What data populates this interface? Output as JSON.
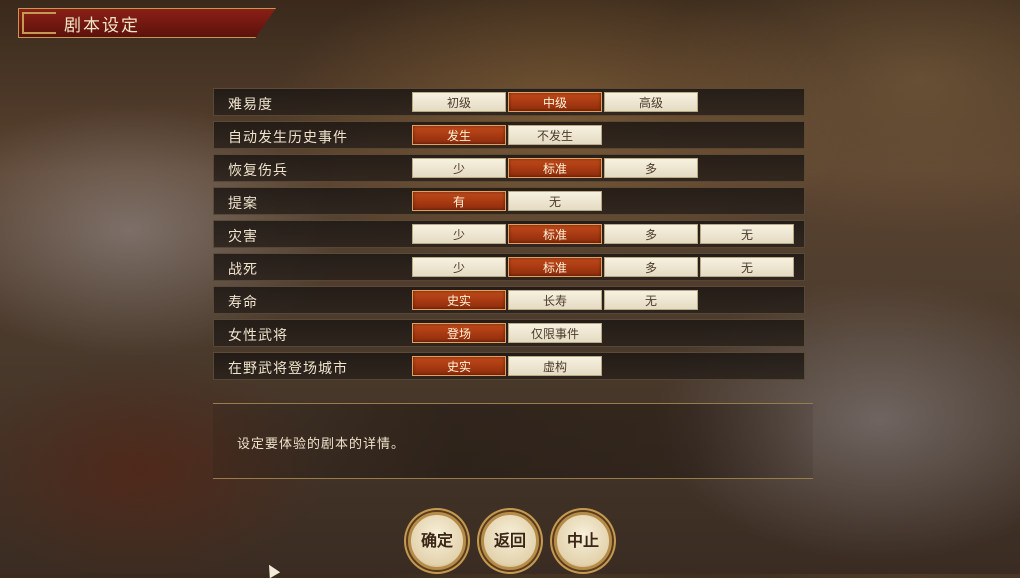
{
  "header": {
    "title": "剧本设定"
  },
  "settings": [
    {
      "label": "难易度",
      "options": [
        "初级",
        "中级",
        "高级"
      ],
      "selected": 1
    },
    {
      "label": "自动发生历史事件",
      "options": [
        "发生",
        "不发生"
      ],
      "selected": 0
    },
    {
      "label": "恢复伤兵",
      "options": [
        "少",
        "标准",
        "多"
      ],
      "selected": 1
    },
    {
      "label": "提案",
      "options": [
        "有",
        "无"
      ],
      "selected": 0
    },
    {
      "label": "灾害",
      "options": [
        "少",
        "标准",
        "多",
        "无"
      ],
      "selected": 1
    },
    {
      "label": "战死",
      "options": [
        "少",
        "标准",
        "多",
        "无"
      ],
      "selected": 1
    },
    {
      "label": "寿命",
      "options": [
        "史实",
        "长寿",
        "无"
      ],
      "selected": 0
    },
    {
      "label": "女性武将",
      "options": [
        "登场",
        "仅限事件"
      ],
      "selected": 0
    },
    {
      "label": "在野武将登场城市",
      "options": [
        "史实",
        "虚构"
      ],
      "selected": 0
    }
  ],
  "description": "设定要体验的剧本的详情。",
  "buttons": {
    "confirm": "确定",
    "back": "返回",
    "stop": "中止"
  },
  "colors": {
    "selected": "#b23d14",
    "title_bar": "#7a1a12",
    "gold": "#c49a52"
  }
}
